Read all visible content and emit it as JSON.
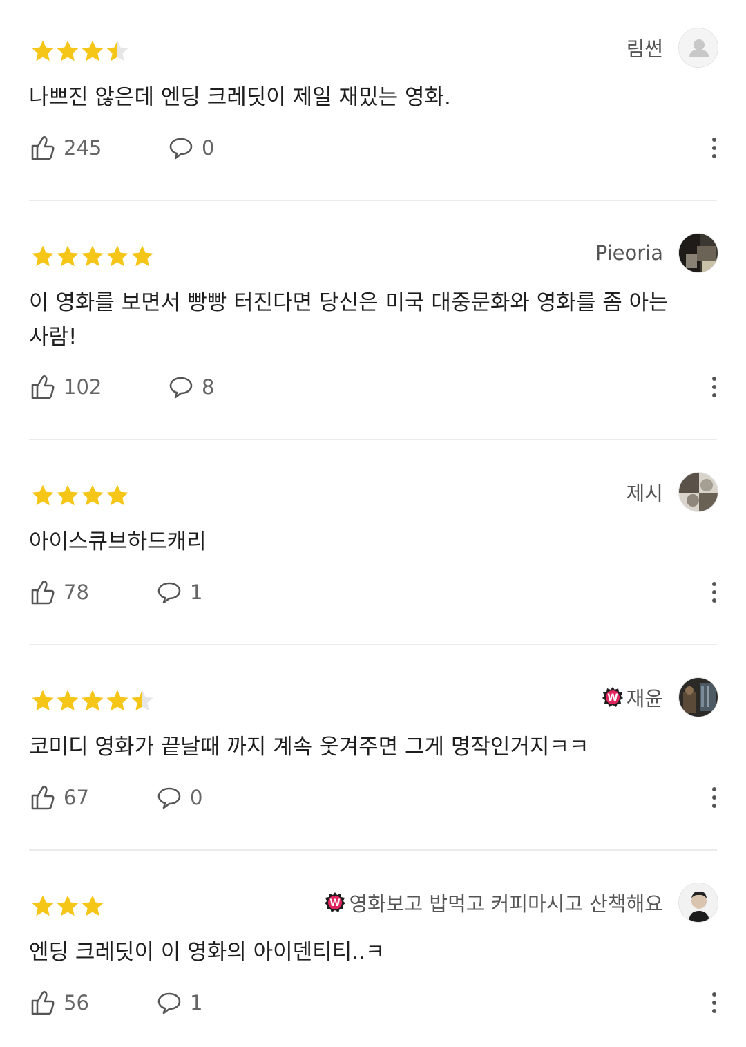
{
  "colors": {
    "star": "#f5c518",
    "star_empty": "#e6e6e6",
    "badge": "#e0245e",
    "divider": "#ebebeb"
  },
  "reviews": [
    {
      "rating": 3.5,
      "user": "림썬",
      "badge": false,
      "avatar": "default-avatar",
      "comment": "나쁘진 않은데 엔딩 크레딧이 제일 재밌는 영화.",
      "likes": "245",
      "replies": "0"
    },
    {
      "rating": 5,
      "user": "Pieoria",
      "badge": false,
      "avatar": "photo-avatar",
      "comment": "이 영화를 보면서 빵빵 터진다면 당신은 미국 대중문화와 영화를 좀 아는 사람!",
      "likes": "102",
      "replies": "8"
    },
    {
      "rating": 4,
      "user": "제시",
      "badge": false,
      "avatar": "photo-avatar",
      "comment": "아이스큐브하드캐리",
      "likes": "78",
      "replies": "1"
    },
    {
      "rating": 4.5,
      "user": "재윤",
      "badge": true,
      "avatar": "photo-avatar",
      "comment": "코미디 영화가 끝날때 까지 계속 웃겨주면 그게 명작인거지ㅋㅋ",
      "likes": "67",
      "replies": "0"
    },
    {
      "rating": 3,
      "user": "영화보고 밥먹고 커피마시고 산책해요",
      "badge": true,
      "avatar": "photo-avatar",
      "comment": "엔딩 크레딧이 이 영화의 아이덴티티..ㅋ",
      "likes": "56",
      "replies": "1"
    }
  ]
}
